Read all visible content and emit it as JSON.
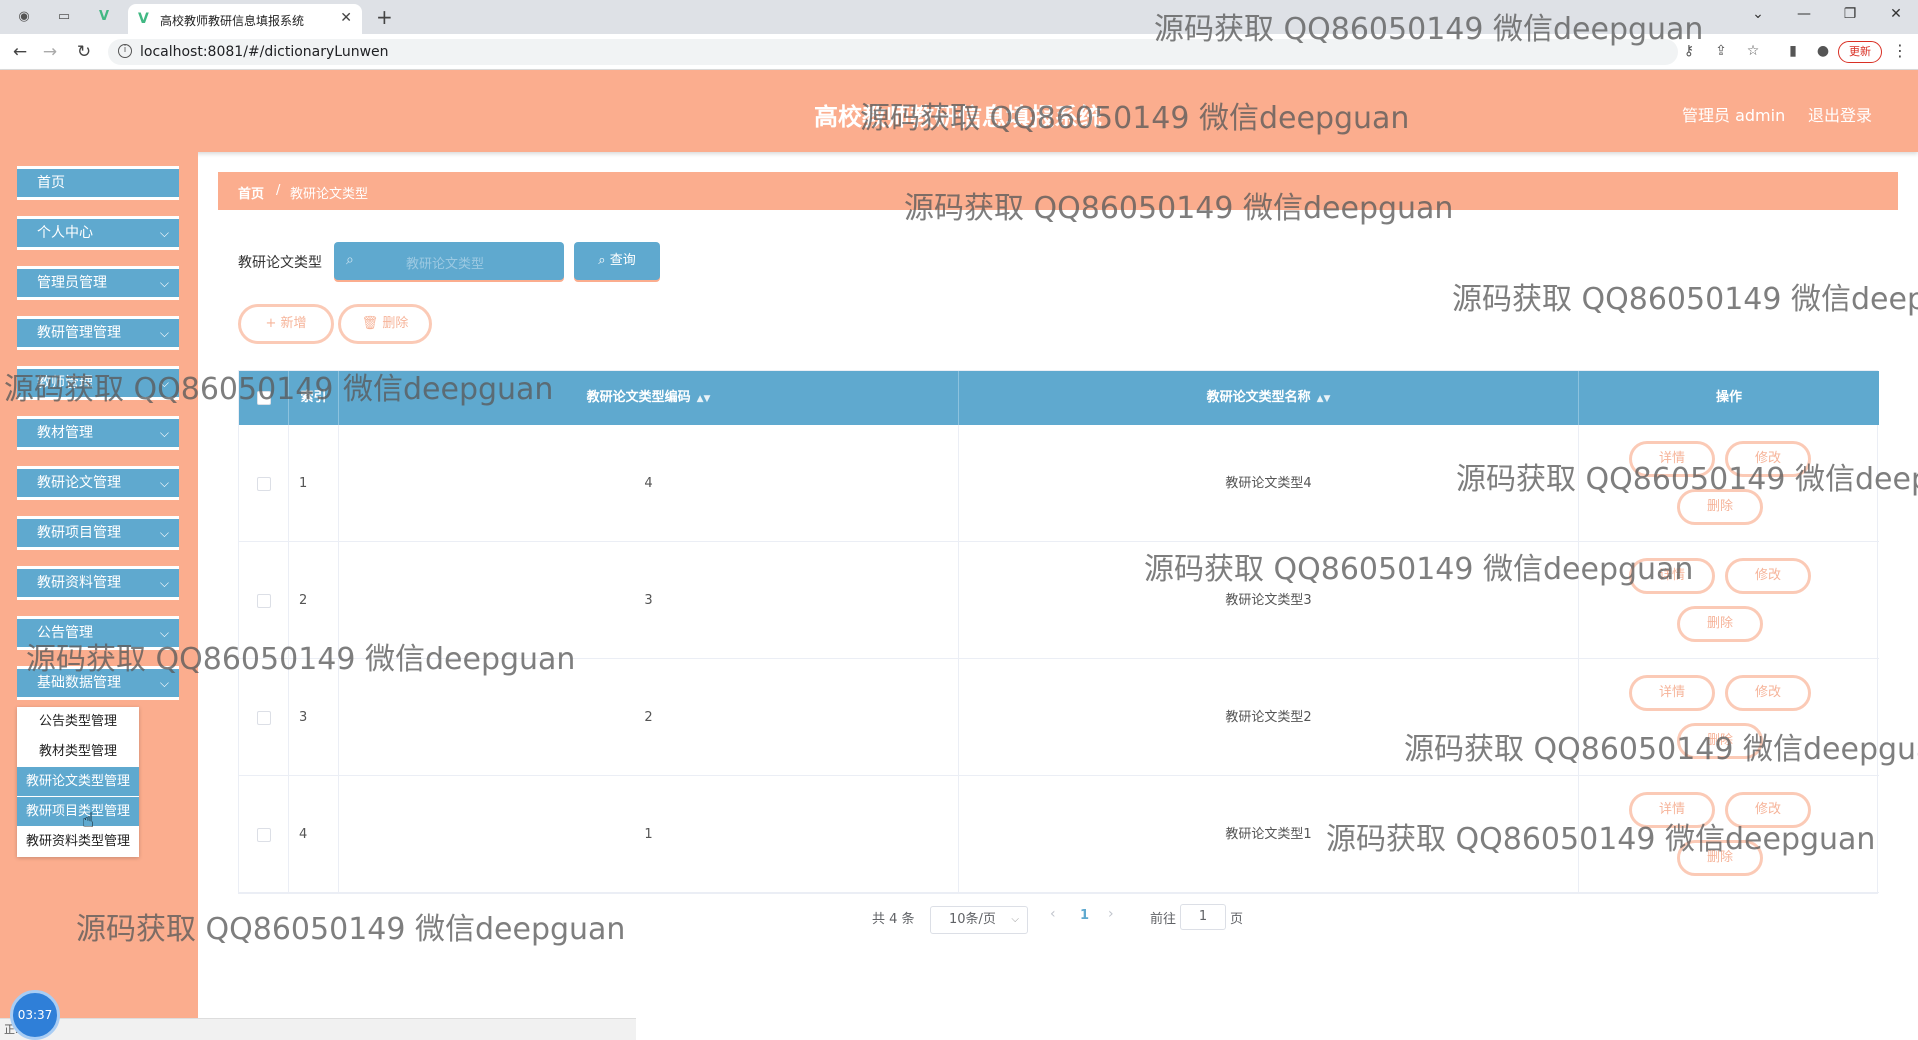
{
  "browser": {
    "tab_title": "高校教师教研信息填报系统",
    "url": "localhost:8081/#/dictionaryLunwen",
    "update_label": "更新",
    "new_tab": "+",
    "close_tab": "✕"
  },
  "header": {
    "title": "高校教师教研信息填报系统",
    "user": "管理员 admin",
    "logout": "退出登录"
  },
  "sidebar": {
    "items": [
      {
        "label": "首页"
      },
      {
        "label": "个人中心"
      },
      {
        "label": "管理员管理"
      },
      {
        "label": "教研管理管理"
      },
      {
        "label": "教师管理"
      },
      {
        "label": "教材管理"
      },
      {
        "label": "教研论文管理"
      },
      {
        "label": "教研项目管理"
      },
      {
        "label": "教研资料管理"
      },
      {
        "label": "公告管理"
      },
      {
        "label": "基础数据管理"
      }
    ],
    "submenu": [
      {
        "label": "公告类型管理"
      },
      {
        "label": "教材类型管理"
      },
      {
        "label": "教研论文类型管理"
      },
      {
        "label": "教研项目类型管理"
      },
      {
        "label": "教研资料类型管理"
      }
    ]
  },
  "breadcrumb": {
    "home": "首页",
    "sep": "/",
    "current": "教研论文类型"
  },
  "search": {
    "label": "教研论文类型",
    "placeholder": "教研论文类型",
    "button": "查询"
  },
  "actions": {
    "add": "+ 新增",
    "delete": "删除"
  },
  "table": {
    "headers": {
      "index": "索引",
      "code": "教研论文类型编码",
      "name": "教研论文类型名称",
      "op": "操作"
    },
    "rows": [
      {
        "index": "1",
        "code": "4",
        "name": "教研论文类型4"
      },
      {
        "index": "2",
        "code": "3",
        "name": "教研论文类型3"
      },
      {
        "index": "3",
        "code": "2",
        "name": "教研论文类型2"
      },
      {
        "index": "4",
        "code": "1",
        "name": "教研论文类型1"
      }
    ],
    "row_actions": {
      "detail": "详情",
      "edit": "修改",
      "delete": "删除"
    }
  },
  "pagination": {
    "total": "共 4 条",
    "page_size": "10条/页",
    "current": "1",
    "goto": "前往",
    "page_input": "1",
    "page_suffix": "页"
  },
  "watermark": "源码获取 QQ86050149 微信deepguan",
  "overlay": {
    "timer": "03:37",
    "status": "正..."
  },
  "colors": {
    "accent": "#fbad8e",
    "primary": "#5fa9cf"
  }
}
